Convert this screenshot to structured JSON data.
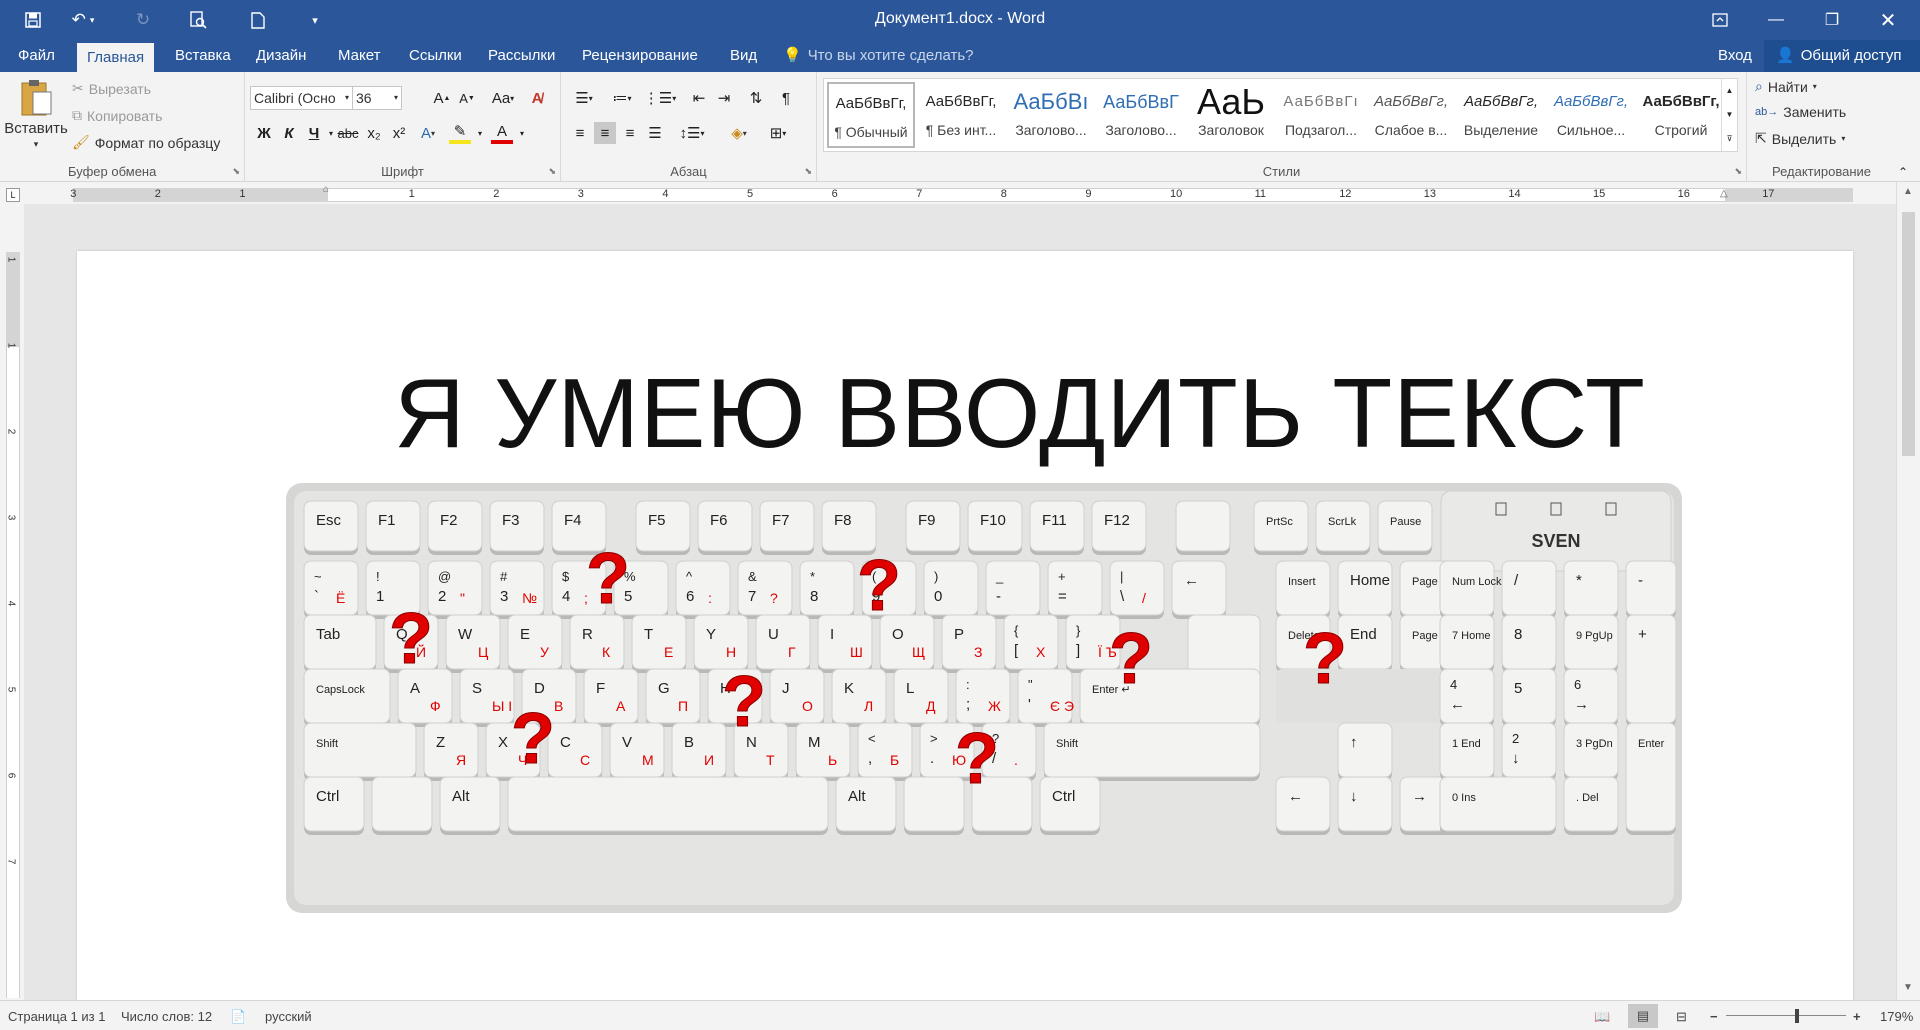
{
  "titlebar": {
    "title": "Документ1.docx - Word"
  },
  "tabs": [
    "Файл",
    "Главная",
    "Вставка",
    "Дизайн",
    "Макет",
    "Ссылки",
    "Рассылки",
    "Рецензирование",
    "Вид"
  ],
  "tell_me": "Что вы хотите сделать?",
  "login": "Вход",
  "share": "Общий доступ",
  "clipboard": {
    "paste": "Вставить",
    "cut": "Вырезать",
    "copy": "Копировать",
    "format_painter": "Формат по образцу",
    "label": "Буфер обмена"
  },
  "font": {
    "name": "Calibri (Осно",
    "size": "36",
    "label": "Шрифт",
    "bold": "Ж",
    "italic": "К",
    "underline": "Ч",
    "strike": "abc",
    "sub": "x₂",
    "sup": "x²",
    "case": "Aa",
    "grow": "A",
    "shrink": "A"
  },
  "paragraph": {
    "label": "Абзац"
  },
  "styles": {
    "label": "Стили",
    "items": [
      {
        "preview": "АаБбВвГг,",
        "name": "¶ Обычный"
      },
      {
        "preview": "АаБбВвГг,",
        "name": "¶ Без инт..."
      },
      {
        "preview": "АаБбВı",
        "name": "Заголово..."
      },
      {
        "preview": "АаБбВвГ",
        "name": "Заголово..."
      },
      {
        "preview": "АаЬ",
        "name": "Заголовок"
      },
      {
        "preview": "АаБбВвГı",
        "name": "Подзагол..."
      },
      {
        "preview": "АаБбВвГг,",
        "name": "Слабое в..."
      },
      {
        "preview": "АаБбВвГг,",
        "name": "Выделение"
      },
      {
        "preview": "АаБбВвГг,",
        "name": "Сильное..."
      },
      {
        "preview": "АаБбВвГг,",
        "name": "Строгий"
      }
    ]
  },
  "editing": {
    "label": "Редактирование",
    "find": "Найти",
    "replace": "Заменить",
    "select": "Выделить"
  },
  "ruler": {
    "numbers": [
      "3",
      "2",
      "1",
      "1",
      "2",
      "3",
      "4",
      "5",
      "6",
      "7",
      "8",
      "9",
      "10",
      "11",
      "12",
      "13",
      "14",
      "15",
      "16",
      "17"
    ]
  },
  "vruler": {
    "numbers": [
      "1",
      "1",
      "2",
      "3",
      "4",
      "5",
      "6",
      "7"
    ]
  },
  "document": {
    "heading": "Я УМЕЮ ВВОДИТЬ ТЕКСТ"
  },
  "keyboard": {
    "brand": "SVEN",
    "accent_color": "#e00000",
    "rows": {
      "fn": [
        "Esc",
        "F1",
        "F2",
        "F3",
        "F4",
        "F5",
        "F6",
        "F7",
        "F8",
        "F9",
        "F10",
        "F11",
        "F12",
        "",
        "PrtSc",
        "ScrLk",
        "Pause"
      ],
      "num": [
        {
          "t": "~ `",
          "r": "Ё"
        },
        {
          "t": "! 1",
          "r": ""
        },
        {
          "t": "@ 2",
          "r": "\""
        },
        {
          "t": "# 3",
          "r": "№"
        },
        {
          "t": "$ 4",
          "r": ";"
        },
        {
          "t": "% 5",
          "r": ""
        },
        {
          "t": "^ 6",
          "r": ":"
        },
        {
          "t": "& 7",
          "r": "?"
        },
        {
          "t": "* 8",
          "r": ""
        },
        {
          "t": "( 9",
          "r": ""
        },
        {
          "t": ") 0",
          "r": ""
        },
        {
          "t": "_ -",
          "r": ""
        },
        {
          "t": "+ =",
          "r": ""
        },
        {
          "t": "| \\",
          "r": "/"
        },
        {
          "t": "←",
          "r": ""
        }
      ],
      "q": [
        {
          "t": "Tab",
          "r": ""
        },
        {
          "t": "Q",
          "r": "Й"
        },
        {
          "t": "W",
          "r": "Ц"
        },
        {
          "t": "E",
          "r": "У"
        },
        {
          "t": "R",
          "r": "К"
        },
        {
          "t": "T",
          "r": "Е"
        },
        {
          "t": "Y",
          "r": "Н"
        },
        {
          "t": "U",
          "r": "Г"
        },
        {
          "t": "I",
          "r": "Ш"
        },
        {
          "t": "O",
          "r": "Щ"
        },
        {
          "t": "P",
          "r": "З"
        },
        {
          "t": "{ [",
          "r": "Х"
        },
        {
          "t": "} ]",
          "r": "Ї Ъ"
        }
      ],
      "a": [
        {
          "t": "CapsLock",
          "r": ""
        },
        {
          "t": "A",
          "r": "Ф"
        },
        {
          "t": "S",
          "r": "Ы І"
        },
        {
          "t": "D",
          "r": "В"
        },
        {
          "t": "F",
          "r": "А"
        },
        {
          "t": "G",
          "r": "П"
        },
        {
          "t": "H",
          "r": "Р"
        },
        {
          "t": "J",
          "r": "О"
        },
        {
          "t": "K",
          "r": "Л"
        },
        {
          "t": "L",
          "r": "Д"
        },
        {
          "t": ": ;",
          "r": "Ж"
        },
        {
          "t": "\" '",
          "r": "Є Э"
        },
        {
          "t": "Enter",
          "r": ""
        }
      ],
      "z": [
        {
          "t": "Shift",
          "r": ""
        },
        {
          "t": "Z",
          "r": "Я"
        },
        {
          "t": "X",
          "r": "Ч"
        },
        {
          "t": "C",
          "r": "С"
        },
        {
          "t": "V",
          "r": "М"
        },
        {
          "t": "B",
          "r": "И"
        },
        {
          "t": "N",
          "r": "Т"
        },
        {
          "t": "M",
          "r": "Ь"
        },
        {
          "t": "< ,",
          "r": "Б"
        },
        {
          "t": "> .",
          "r": "Ю"
        },
        {
          "t": "? /",
          "r": "."
        },
        {
          "t": "Shift",
          "r": ""
        }
      ],
      "bottom": [
        "Ctrl",
        "",
        "Alt",
        "",
        "Alt",
        "",
        "",
        "Ctrl"
      ],
      "nav_top": [
        "Insert",
        "Home",
        "Page Up"
      ],
      "nav_mid": [
        "Delete",
        "End",
        "Page Down"
      ],
      "arrows": [
        "↑",
        "←",
        "↓",
        "→"
      ],
      "numpad": [
        "Num Lock",
        "/",
        "*",
        "-",
        "7 Home",
        "8",
        "9 PgUp",
        "+",
        "4 ←",
        "5",
        "6 →",
        "1 End",
        "2 ↓",
        "3 PgDn",
        "Enter",
        "0 Ins",
        ". Del"
      ]
    }
  },
  "status": {
    "page": "Страница 1 из 1",
    "words": "Число слов: 12",
    "lang": "русский",
    "zoom": "179%"
  }
}
